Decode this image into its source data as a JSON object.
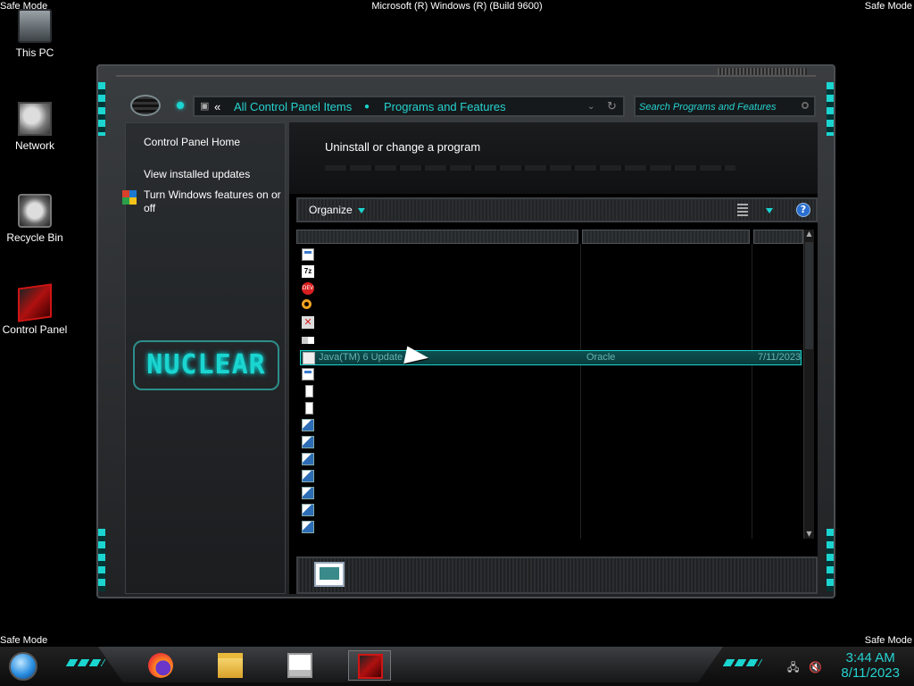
{
  "os": {
    "safe_mode": "Safe Mode",
    "title": "Microsoft (R) Windows (R) (Build 9600)"
  },
  "desktop": {
    "icons": [
      {
        "label": "This PC",
        "icon": "this-pc-icon"
      },
      {
        "label": "Network",
        "icon": "network-icon"
      },
      {
        "label": "Recycle Bin",
        "icon": "recycle-bin-icon"
      },
      {
        "label": "Control Panel",
        "icon": "control-panel-icon"
      }
    ]
  },
  "window": {
    "breadcrumb_back": "«",
    "breadcrumb": [
      "All Control Panel Items",
      "Programs and Features"
    ],
    "search_placeholder": "Search Programs and Features",
    "left_pane": {
      "home": "Control Panel Home",
      "updates": "View installed updates",
      "features": "Turn Windows features on or off"
    },
    "brand": "NUCLEAR",
    "heading": "Uninstall or change a program",
    "toolbar": {
      "organize": "Organize",
      "help": "?"
    },
    "selected_row": {
      "name": "Java(TM) 6 Update ...",
      "publisher": "Oracle",
      "installed": "7/11/2023"
    },
    "row_icons": [
      "windows-app-icon",
      "7zip-icon",
      "dev-cpp-icon",
      "search-app-icon",
      "x-app-icon",
      "key-icon",
      "java-icon",
      "windows-app-icon",
      "document-icon",
      "document-icon",
      "vc-redist-icon",
      "vc-redist-icon",
      "vc-redist-icon",
      "vc-redist-icon",
      "vc-redist-icon",
      "vc-redist-icon",
      "vc-redist-icon"
    ]
  },
  "taskbar": {
    "apps": [
      "Firefox",
      "File Explorer",
      "Remote Desktop",
      "Control Panel"
    ],
    "clock_time": "3:44 AM",
    "clock_date": "8/11/2023"
  },
  "colors": {
    "accent": "#1bd5d0",
    "breadcrumb": "#25d3d0",
    "selection": "#0d4f50"
  }
}
